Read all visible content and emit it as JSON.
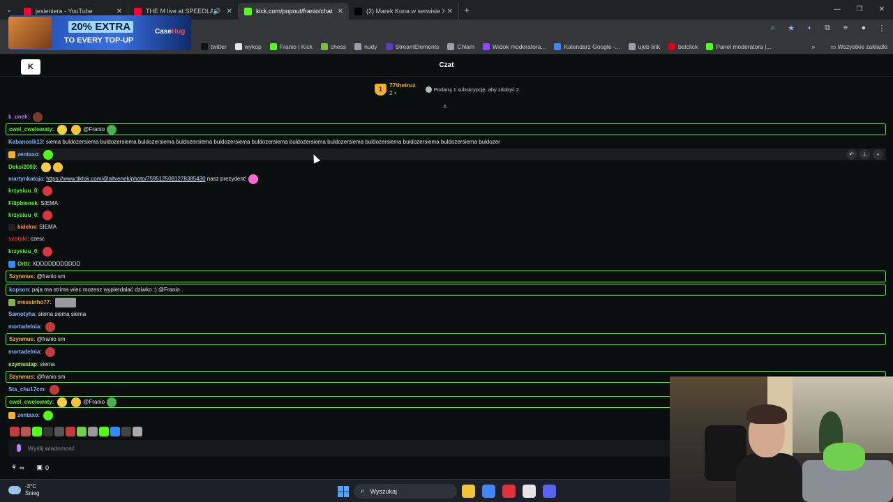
{
  "browser": {
    "tabs": [
      {
        "title": "jesieniera - YouTube",
        "color": "#ff0033",
        "active": false
      },
      {
        "title": "THE M live at SPEEDLAND",
        "color": "#ff0033",
        "active": false,
        "audio": true
      },
      {
        "title": "kick.com/popout/franio/chat",
        "color": "#53fc18",
        "active": true
      },
      {
        "title": "(2) Marek Kuna w serwisie X",
        "color": "#000000",
        "active": false
      }
    ],
    "bookmarks": [
      {
        "label": "twitter",
        "icon": "x-icon",
        "color": "#111111"
      },
      {
        "label": "wykop",
        "icon": "wykop-icon",
        "color": "#e5e5e5"
      },
      {
        "label": "Franio | Kick",
        "icon": "kick-icon",
        "color": "#53fc18"
      },
      {
        "label": "chess",
        "icon": "pawn-icon",
        "color": "#81b64c"
      },
      {
        "label": "nudy",
        "icon": "folder-icon",
        "color": "#9aa0a6"
      },
      {
        "label": "StreamElements",
        "icon": "streamelements-icon",
        "color": "#5b3cc4"
      },
      {
        "label": "Chłam",
        "icon": "globe-icon",
        "color": "#9aa0a6"
      },
      {
        "label": "Widok moderatora...",
        "icon": "twitch-icon",
        "color": "#9146ff"
      },
      {
        "label": "Kalendarz Google -...",
        "icon": "calendar-icon",
        "color": "#4285f4"
      },
      {
        "label": "ujeb link",
        "icon": "globe-icon",
        "color": "#9aa0a6"
      },
      {
        "label": "betclick",
        "icon": "betclick-icon",
        "color": "#e2001a"
      },
      {
        "label": "Panel moderatora |...",
        "icon": "kick-icon",
        "color": "#53fc18"
      }
    ],
    "all_bookmarks": "Wszystkie zakładki"
  },
  "ad": {
    "headline": "20% EXTRA",
    "subline": "TO EVERY TOP-UP",
    "brand_a": "Case",
    "brand_b": "Hug"
  },
  "kick": {
    "title": "Czat",
    "gifter": {
      "rank": "1",
      "name": "77thetruz",
      "count": "2",
      "message": "Podaruj 1 subskrypcję, aby zdobyć 2."
    },
    "input_placeholder": "Wyślij wiadomość",
    "points": "∞",
    "gift_count": "0"
  },
  "chat": [
    {
      "user": "k_unek",
      "color": "#b57bff",
      "text": "",
      "emotes": [
        "#7a3b2c"
      ],
      "highlight": false
    },
    {
      "user": "cwel_cwelowaty",
      "color": "#53fc18",
      "text": "@Franio",
      "pre_emotes": [
        "#f5d142",
        "#f5c33b"
      ],
      "emotes": [
        "#4caf50"
      ],
      "highlight": true
    },
    {
      "user": "Kabanosik13",
      "color": "#7fb3ff",
      "text": "siema buldozersiema buldozersiema buldozersiema buldozersiema buldozersiema buldozersiema buldozersiema buldozersiema buldozersiema buldozersiema buldozersiema buldozer",
      "emotes": [],
      "highlight": false
    },
    {
      "user": "zentaxo",
      "color": "#7fb3ff",
      "text": "",
      "emotes": [
        "#53fc18"
      ],
      "badge": "#f3b12a",
      "highlight": false,
      "hover": true
    },
    {
      "user": "Deksi2009",
      "color": "#53fc18",
      "text": "",
      "emotes": [
        "#f5d142",
        "#f5c33b"
      ],
      "highlight": false
    },
    {
      "user": "martynkatoja",
      "color": "#7fb3ff",
      "link": "https://www.tiktok.com/@altvenek/photo/7595125081278385430",
      "text": " nasz prezydent!",
      "emotes": [
        "#ff6ad5"
      ],
      "highlight": false
    },
    {
      "user": "krzysiuu_0",
      "color": "#53fc18",
      "text": "",
      "emotes": [
        "#d9363e"
      ],
      "highlight": false
    },
    {
      "user": "Filipbienek",
      "color": "#53fc18",
      "text": "SIEMA",
      "emotes": [],
      "highlight": false
    },
    {
      "user": "krzysiuu_0",
      "color": "#53fc18",
      "text": "",
      "emotes": [
        "#d9363e"
      ],
      "highlight": false
    },
    {
      "user": "kidekw",
      "color": "#ff8c3a",
      "text": "SIEMA",
      "emotes": [],
      "badge": "#222222",
      "highlight": false
    },
    {
      "user": "szotyki",
      "color": "#e0303a",
      "text": "czesc",
      "emotes": [],
      "highlight": false
    },
    {
      "user": "krzysiuu_0",
      "color": "#53fc18",
      "text": "",
      "emotes": [
        "#d9363e"
      ],
      "highlight": false
    },
    {
      "user": "Ortti",
      "color": "#53fc18",
      "text": "XDDDDDDDDDDD",
      "emotes": [],
      "badge": "#2f8cff",
      "highlight": false
    },
    {
      "user": "Szynmus",
      "color": "#f3b12a",
      "text": "@franio sm",
      "emotes": [],
      "highlight": true
    },
    {
      "user": "kopson",
      "color": "#7fb3ff",
      "text": "paja ma strima wiec mozesz wypierdalać dziwko :) @Franio .",
      "emotes": [],
      "highlight": true
    },
    {
      "user": "messinho77",
      "color": "#f3b12a",
      "text": "",
      "emotes": [
        "#9a9a9a"
      ],
      "badge": "#81b64c",
      "highlight": false
    },
    {
      "user": "Samotyha",
      "color": "#7fb3ff",
      "text": "siema siema siema",
      "emotes": [],
      "highlight": false
    },
    {
      "user": "mortadelnia",
      "color": "#7fb3ff",
      "text": "",
      "emotes": [
        "#c43a3a"
      ],
      "highlight": false
    },
    {
      "user": "Szynmus",
      "color": "#f3b12a",
      "text": "@franio sm",
      "emotes": [],
      "highlight": true
    },
    {
      "user": "mortadelnia",
      "color": "#7fb3ff",
      "text": "",
      "emotes": [
        "#c43a3a"
      ],
      "highlight": false
    },
    {
      "user": "szymusiap",
      "color": "#b5f26b",
      "text": "siema",
      "emotes": [],
      "highlight": false
    },
    {
      "user": "Szynmus",
      "color": "#f3b12a",
      "text": "@franio sm",
      "emotes": [],
      "highlight": true
    },
    {
      "user": "Sta_chu17cm",
      "color": "#7fb3ff",
      "text": "",
      "emotes": [
        "#c43a3a"
      ],
      "highlight": false
    },
    {
      "user": "cwel_cwelowaty",
      "color": "#53fc18",
      "text": "@Franio",
      "pre_emotes": [
        "#f5d142",
        "#f5c33b"
      ],
      "emotes": [
        "#4caf50"
      ],
      "highlight": true
    },
    {
      "user": "zentaxo",
      "color": "#7fb3ff",
      "text": "",
      "emotes": [
        "#53fc18"
      ],
      "badge": "#f3b12a",
      "highlight": false
    }
  ],
  "emote_bar": [
    "#c43a3a",
    "#b55",
    "#53fc18",
    "#333",
    "#555",
    "#c43a3a",
    "#6fcf4f",
    "#999",
    "#53fc18",
    "#2f8cff",
    "#444",
    "#aaa"
  ],
  "taskbar": {
    "temp": "-3°C",
    "weather": "Śnieg",
    "search": "Wyszukaj",
    "apps": [
      {
        "name": "explorer-icon",
        "color": "#f5c33b"
      },
      {
        "name": "chrome-icon",
        "color": "#4285f4"
      },
      {
        "name": "app-icon",
        "color": "#e0303a"
      },
      {
        "name": "app-icon",
        "color": "#e5e5e5"
      },
      {
        "name": "discord-icon",
        "color": "#5865f2"
      }
    ]
  }
}
